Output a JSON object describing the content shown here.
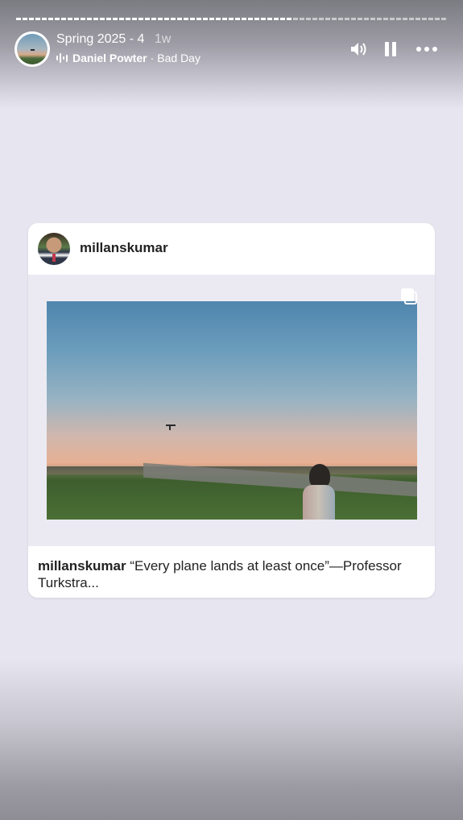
{
  "story": {
    "progress_fraction": 0.645,
    "title": "Spring 2025 - 4",
    "age": "1w",
    "music": {
      "artist": "Daniel Powter",
      "separator": "·",
      "song": "Bad Day"
    }
  },
  "controls": {
    "volume_icon": "volume-icon",
    "pause_icon": "pause-icon",
    "more_icon": "more-options-icon"
  },
  "post": {
    "username": "millanskumar",
    "multi_photo_icon": "carousel-icon",
    "caption_username": "millanskumar",
    "caption_text": "“Every plane lands at least once”—Professor Turkstra..."
  }
}
